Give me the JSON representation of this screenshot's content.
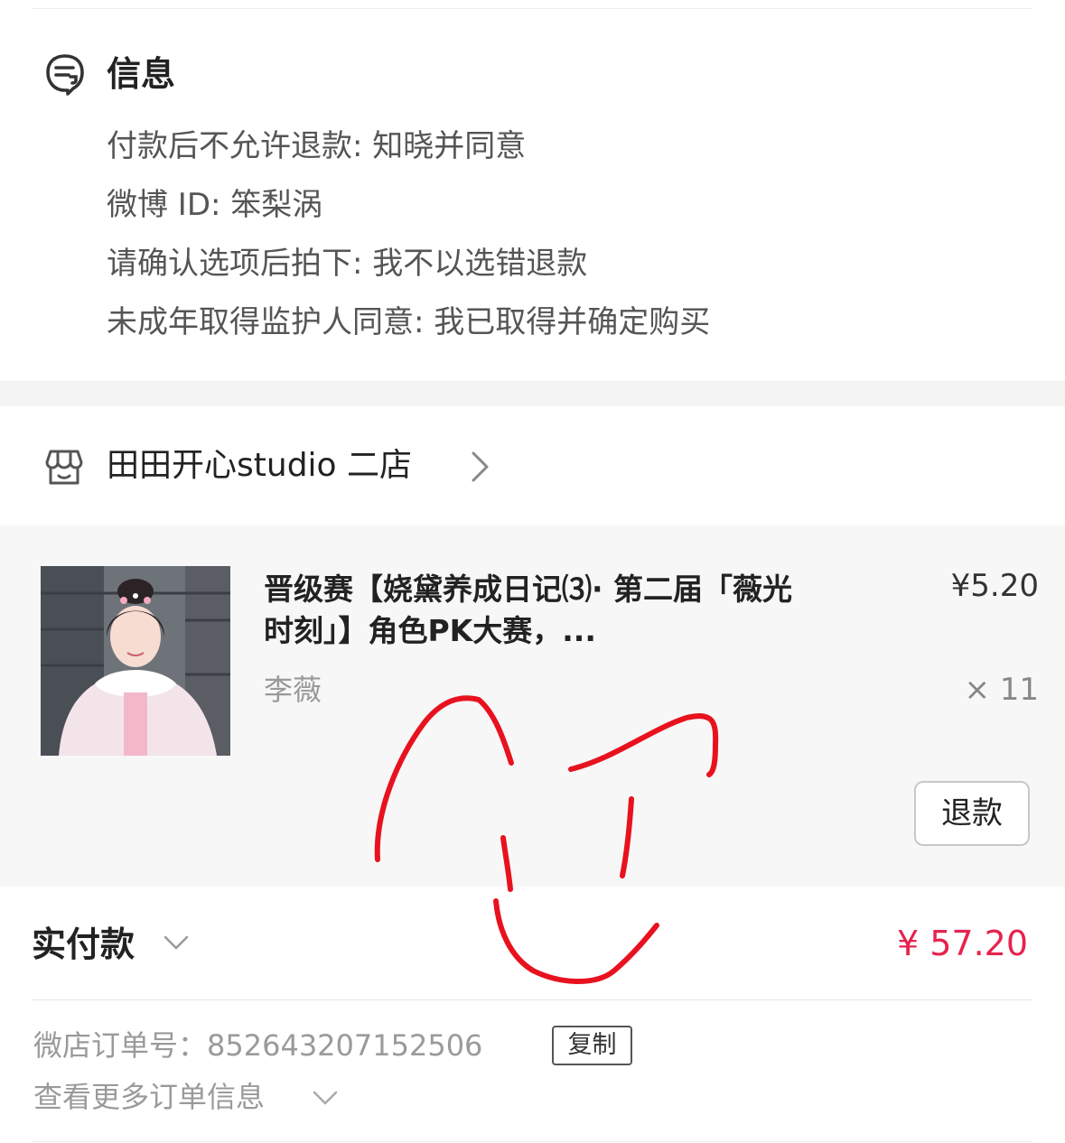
{
  "info": {
    "title": "信息",
    "icon": "message-note-icon",
    "lines": [
      "付款后不允许退款: 知晓并同意",
      "微博 ID: 笨梨涡",
      "请确认选项后拍下: 我不以选错退款",
      "未成年取得监护人同意: 我已取得并确定购买"
    ]
  },
  "shop": {
    "icon": "storefront-icon",
    "name": "田田开心studio 二店",
    "chevron": "chevron-right-icon"
  },
  "product": {
    "title": "晋级赛【娆黛养成日记⑶· 第二届「薇光时刻」】角色PK大赛，...",
    "variant": "李薇",
    "price": "¥5.20",
    "quantity": "× 11",
    "refund_label": "退款",
    "image": "product-photo-woman-in-pink-hanfu"
  },
  "payment": {
    "label": "实付款",
    "amount": "¥ 57.20"
  },
  "order": {
    "number_label": "微店订单号：",
    "number_value": "852643207152506",
    "copy_label": "复制",
    "more_label": "查看更多订单信息"
  },
  "colors": {
    "accent": "#e6224e",
    "scribble": "#e8121f",
    "card_bg": "#f7f7f7",
    "section_gap": "#f4f4f4"
  }
}
